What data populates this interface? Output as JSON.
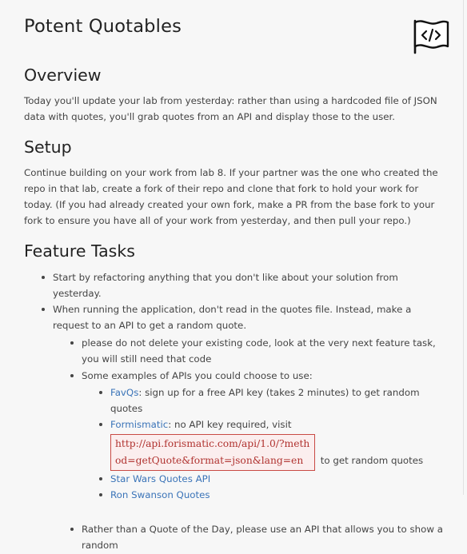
{
  "title": "Potent Quotables",
  "overview": {
    "heading": "Overview",
    "text": "Today you'll update your lab from yesterday: rather than using a hardcoded file of JSON data with quotes, you'll grab quotes from an API and display those to the user."
  },
  "setup": {
    "heading": "Setup",
    "text": "Continue building on your work from lab 8. If your partner was the one who created the repo in that lab, create a fork of their repo and clone that fork to hold your work for today. (If you had already created your own fork, make a PR from the base fork to your fork to ensure you have all of your work from yesterday, and then pull your repo.)"
  },
  "features": {
    "heading": "Feature Tasks",
    "item1": "Start by refactoring anything that you don't like about your solution from yesterday.",
    "item2": "When running the application, don't read in the quotes file. Instead, make a request to an API to get a random quote.",
    "sub1": "please do not delete your existing code, look at the very next feature task, you will still need that code",
    "sub2": "Some examples of APIs you could choose to use:",
    "apis": {
      "favqs_link": "FavQs",
      "favqs_text": ": sign up for a free API key (takes 2 minutes) to get random quotes",
      "formismatic_link": "Formismatic",
      "formismatic_text": ": no API key required, visit",
      "formismatic_url": "http://api.forismatic.com/api/1.0/?method=getQuote&format=json&lang=en",
      "formismatic_after": "to get random quotes",
      "starwars_link": "Star Wars Quotes API",
      "ron_link": "Ron Swanson Quotes"
    },
    "sub3": "Rather than a Quote of the Day, please use an API that allows you to show a random"
  },
  "colors": {
    "link": "#3b74b8",
    "code_text": "#b0322f",
    "code_border": "#c94a44"
  }
}
